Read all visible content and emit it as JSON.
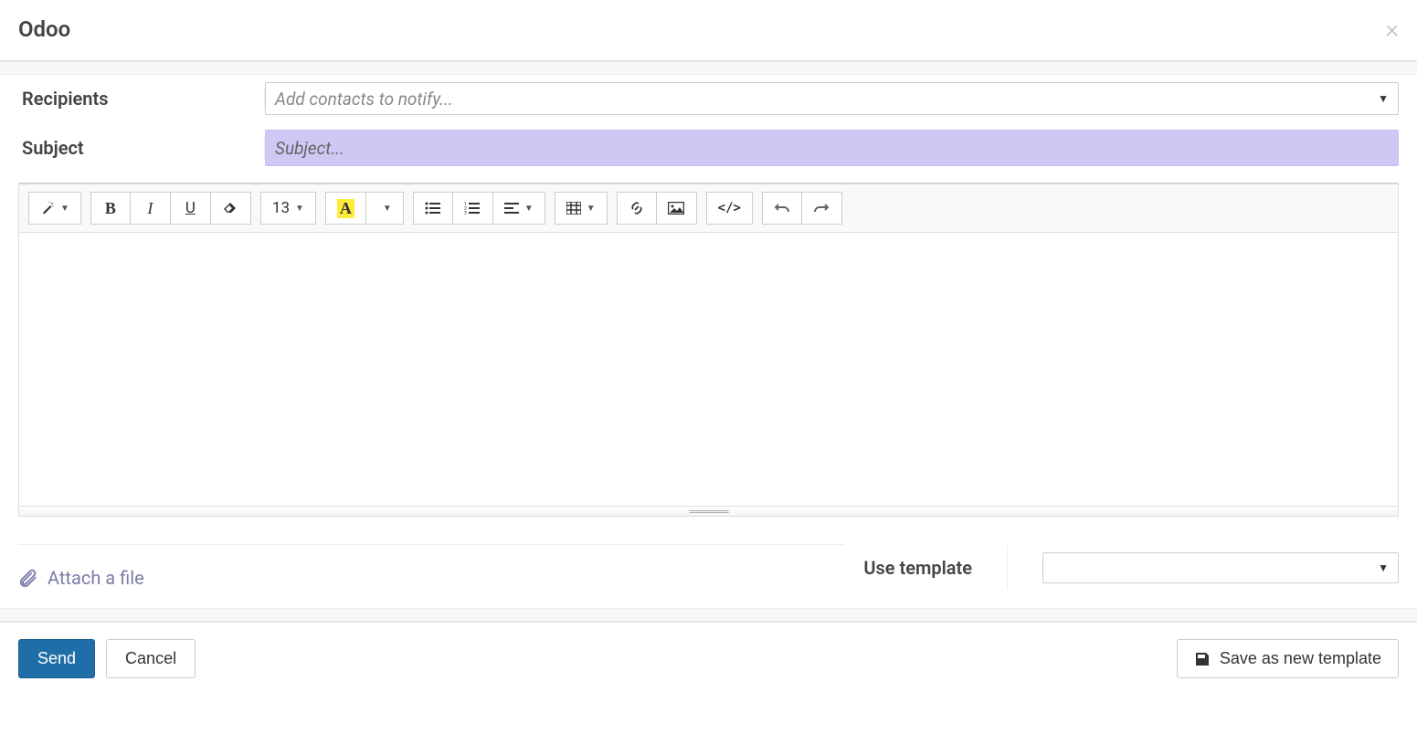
{
  "header": {
    "title": "Odoo"
  },
  "form": {
    "recipients_label": "Recipients",
    "recipients_placeholder": "Add contacts to notify...",
    "subject_label": "Subject",
    "subject_placeholder": "Subject..."
  },
  "toolbar": {
    "font_size": "13",
    "magic_icon": "magic-wand",
    "bold_icon": "B",
    "italic_icon": "I",
    "underline_icon": "U",
    "eraser_icon": "eraser",
    "font_a": "A",
    "ul_icon": "ul",
    "ol_icon": "ol",
    "align_icon": "align",
    "table_icon": "table",
    "link_icon": "link",
    "image_icon": "image",
    "code_icon": "</>",
    "undo_icon": "undo",
    "redo_icon": "redo"
  },
  "attach": {
    "label": "Attach a file"
  },
  "template": {
    "label": "Use template",
    "selected": ""
  },
  "footer": {
    "send": "Send",
    "cancel": "Cancel",
    "save_template": "Save as new template"
  }
}
